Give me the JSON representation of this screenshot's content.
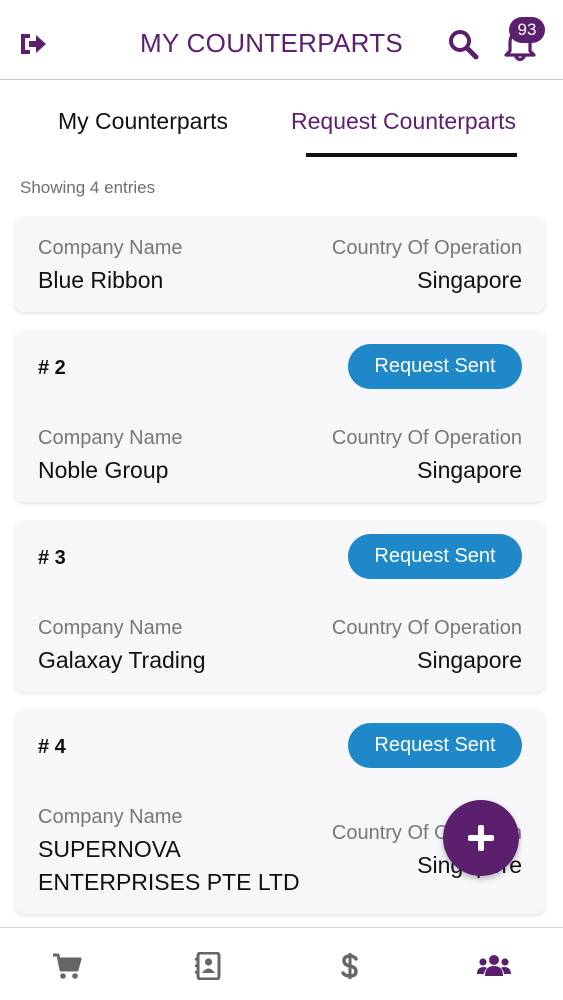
{
  "header": {
    "title": "MY COUNTERPARTS",
    "notification_count": "93",
    "icons": [
      "logout-icon",
      "search-icon",
      "bell-icon"
    ]
  },
  "tabs": [
    {
      "label": "My Counterparts",
      "active": false
    },
    {
      "label": "Request Counterparts",
      "active": true
    }
  ],
  "entries_text": "Showing 4 entries",
  "cards": [
    {
      "index": "",
      "status": "",
      "company_label": "Company Name",
      "company": "Blue Ribbon",
      "country_label": "Country Of Operation",
      "country": "Singapore"
    },
    {
      "index": "# 2",
      "status": "Request Sent",
      "company_label": "Company Name",
      "company": "Noble Group",
      "country_label": "Country Of Operation",
      "country": "Singapore"
    },
    {
      "index": "# 3",
      "status": "Request Sent",
      "company_label": "Company Name",
      "company": "Galaxay Trading",
      "country_label": "Country Of Operation",
      "country": "Singapore"
    },
    {
      "index": "# 4",
      "status": "Request Sent",
      "company_label": "Company Name",
      "company_line1": "SUPERNOVA",
      "company_line2": "ENTERPRISES PTE LTD",
      "country_label": "Country Of Operation",
      "country": "Singapore"
    }
  ],
  "fab": {
    "icon": "plus-icon"
  },
  "bottom_nav": [
    {
      "icon": "cart-icon",
      "active": false
    },
    {
      "icon": "contacts-icon",
      "active": false
    },
    {
      "icon": "dollar-icon",
      "active": false
    },
    {
      "icon": "users-icon",
      "active": true
    }
  ],
  "colors": {
    "brand": "#5b1f6e",
    "status_pill": "#1e88c8",
    "card_bg": "#f7f6f8",
    "nav_inactive": "#666666"
  }
}
